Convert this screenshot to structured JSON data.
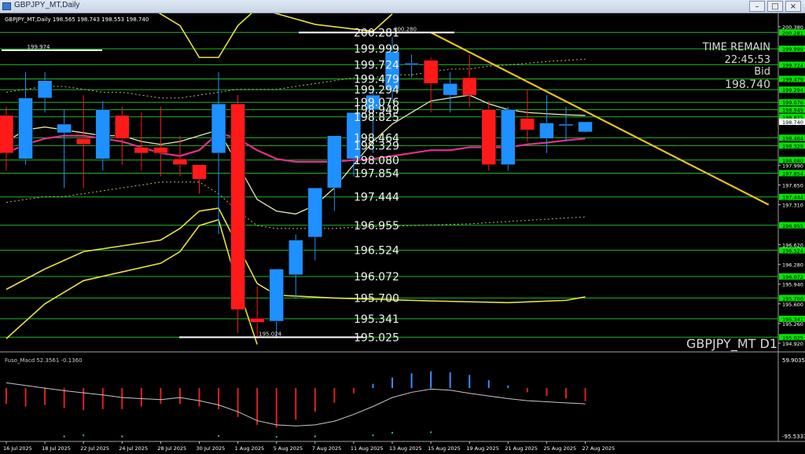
{
  "window": {
    "title": "GBPJPY_MT,Daily",
    "minimize_glyph": "–",
    "maximize_glyph": "□",
    "close_glyph": "×"
  },
  "header": {
    "info": "GBPJPY_MT,Daily   198.565  198.743  198.553  198.740"
  },
  "info_panel": {
    "time_remain_label": "TIME REMAIN",
    "time_remain_value": "22:45:53",
    "bid_label": "Bid",
    "bid_value": "198.740"
  },
  "symbol_watermark": "GBPJPY_MT D1",
  "indicator": {
    "label": "Fuso_Macd 52.3561  -0.1360",
    "scale_top": "59.9035",
    "scale_bottom": "-95.5331",
    "color_main": "#c8c8c8",
    "color_positive": "#3a8cff",
    "color_negative": "#e02020"
  },
  "colors": {
    "background": "#000000",
    "bull_candle": "#1e90ff",
    "bear_candle": "#ff1a1a",
    "level_line": "#2ad82a",
    "trendline": "#e8c020",
    "ma_pink": "#e0308c",
    "band_yellow": "#e8e040",
    "band_white": "#e8e8b0",
    "price_marker": "#00e600"
  },
  "chart_data": {
    "type": "candlestick",
    "symbol": "GBPJPY_MT",
    "timeframe": "Daily",
    "ylim": [
      194.92,
      200.38
    ],
    "price_axis_ticks": [
      "200.380",
      "199.990",
      "197.990",
      "197.650",
      "197.310",
      "196.620",
      "196.280",
      "195.940",
      "195.600",
      "195.260",
      "194.920"
    ],
    "level_lines": [
      {
        "value": 200.281,
        "label": "200.281"
      },
      {
        "value": 199.999,
        "label": "199.999"
      },
      {
        "value": 199.724,
        "label": "199.724"
      },
      {
        "value": 199.479,
        "label": "199.479"
      },
      {
        "value": 199.294,
        "label": "199.294"
      },
      {
        "value": 199.076,
        "label": "199.076"
      },
      {
        "value": 198.949,
        "label": "198.949"
      },
      {
        "value": 198.825,
        "label": "198.825"
      },
      {
        "value": 198.464,
        "label": "198.464"
      },
      {
        "value": 198.329,
        "label": "198.329"
      },
      {
        "value": 198.08,
        "label": "198.080"
      },
      {
        "value": 197.854,
        "label": "197.854"
      },
      {
        "value": 197.444,
        "label": "197.444"
      },
      {
        "value": 196.955,
        "label": "196.955"
      },
      {
        "value": 196.524,
        "label": "196.524"
      },
      {
        "value": 196.072,
        "label": "196.072"
      },
      {
        "value": 195.7,
        "label": "195.700"
      },
      {
        "value": 195.341,
        "label": "195.341"
      },
      {
        "value": 195.025,
        "label": "195.025"
      }
    ],
    "current_price": {
      "value": 198.74,
      "label": "198.740"
    },
    "swing_labels": [
      {
        "value": 199.974,
        "label": "199.974",
        "index": 1
      },
      {
        "value": 200.28,
        "label": "200.280",
        "index": 20
      },
      {
        "value": 195.024,
        "label": "195.024",
        "index": 13
      }
    ],
    "date_labels": [
      {
        "index": 0,
        "label": "16 Jul 2025"
      },
      {
        "index": 2,
        "label": "18 Jul 2025"
      },
      {
        "index": 4,
        "label": "22 Jul 2025"
      },
      {
        "index": 6,
        "label": "24 Jul 2025"
      },
      {
        "index": 8,
        "label": "28 Jul 2025"
      },
      {
        "index": 10,
        "label": "30 Jul 2025"
      },
      {
        "index": 12,
        "label": "1 Aug 2025"
      },
      {
        "index": 14,
        "label": "5 Aug 2025"
      },
      {
        "index": 16,
        "label": "7 Aug 2025"
      },
      {
        "index": 18,
        "label": "11 Aug 2025"
      },
      {
        "index": 20,
        "label": "13 Aug 2025"
      },
      {
        "index": 22,
        "label": "15 Aug 2025"
      },
      {
        "index": 24,
        "label": "19 Aug 2025"
      },
      {
        "index": 26,
        "label": "21 Aug 2025"
      },
      {
        "index": 28,
        "label": "25 Aug 2025"
      },
      {
        "index": 30,
        "label": "27 Aug 2025"
      }
    ],
    "candles": [
      {
        "o": 198.85,
        "h": 199.0,
        "l": 197.9,
        "c": 198.2
      },
      {
        "o": 198.1,
        "h": 199.6,
        "l": 198.0,
        "c": 199.15
      },
      {
        "o": 199.15,
        "h": 199.6,
        "l": 198.9,
        "c": 199.45
      },
      {
        "o": 198.55,
        "h": 198.95,
        "l": 197.6,
        "c": 198.7
      },
      {
        "o": 198.45,
        "h": 199.2,
        "l": 197.6,
        "c": 198.35
      },
      {
        "o": 198.1,
        "h": 199.1,
        "l": 197.9,
        "c": 198.95
      },
      {
        "o": 198.85,
        "h": 199.0,
        "l": 198.0,
        "c": 198.45
      },
      {
        "o": 198.3,
        "h": 198.9,
        "l": 197.9,
        "c": 198.2
      },
      {
        "o": 198.3,
        "h": 199.0,
        "l": 197.8,
        "c": 198.2
      },
      {
        "o": 198.1,
        "h": 198.5,
        "l": 197.8,
        "c": 198.0
      },
      {
        "o": 198.0,
        "h": 197.9,
        "l": 197.5,
        "c": 197.75
      },
      {
        "o": 198.2,
        "h": 199.6,
        "l": 196.8,
        "c": 199.05
      },
      {
        "o": 199.05,
        "h": 199.2,
        "l": 195.1,
        "c": 195.5
      },
      {
        "o": 195.35,
        "h": 195.9,
        "l": 195.0,
        "c": 195.28
      },
      {
        "o": 195.3,
        "h": 196.2,
        "l": 195.0,
        "c": 196.2
      },
      {
        "o": 196.1,
        "h": 196.8,
        "l": 195.7,
        "c": 196.7
      },
      {
        "o": 196.75,
        "h": 197.5,
        "l": 196.35,
        "c": 197.6
      },
      {
        "o": 197.6,
        "h": 198.2,
        "l": 197.2,
        "c": 198.5
      },
      {
        "o": 198.1,
        "h": 198.9,
        "l": 197.8,
        "c": 198.9
      },
      {
        "o": 198.95,
        "h": 199.3,
        "l": 198.2,
        "c": 199.2
      },
      {
        "o": 199.3,
        "h": 200.2,
        "l": 199.1,
        "c": 199.95
      },
      {
        "o": 199.75,
        "h": 199.9,
        "l": 199.5,
        "c": 199.75
      },
      {
        "o": 199.8,
        "h": 199.85,
        "l": 198.9,
        "c": 199.4
      },
      {
        "o": 199.2,
        "h": 199.6,
        "l": 198.9,
        "c": 199.4
      },
      {
        "o": 199.5,
        "h": 199.9,
        "l": 199.0,
        "c": 199.2
      },
      {
        "o": 198.95,
        "h": 199.1,
        "l": 197.9,
        "c": 198.0
      },
      {
        "o": 198.0,
        "h": 199.0,
        "l": 197.9,
        "c": 198.95
      },
      {
        "o": 198.8,
        "h": 199.3,
        "l": 198.4,
        "c": 198.6
      },
      {
        "o": 198.45,
        "h": 199.2,
        "l": 198.2,
        "c": 198.72
      },
      {
        "o": 198.7,
        "h": 199.0,
        "l": 198.4,
        "c": 198.7
      },
      {
        "o": 198.565,
        "h": 198.743,
        "l": 198.553,
        "c": 198.74
      }
    ],
    "ma_pink": [
      198.2,
      198.35,
      198.45,
      198.5,
      198.5,
      198.45,
      198.4,
      198.3,
      198.2,
      198.15,
      198.25,
      198.55,
      198.45,
      198.25,
      198.1,
      198.05,
      198.05,
      198.05,
      198.08,
      198.1,
      198.15,
      198.2,
      198.25,
      198.25,
      198.3,
      198.3,
      198.3,
      198.35,
      198.38,
      198.42,
      198.45
    ],
    "band_white": [
      198.4,
      198.6,
      198.65,
      198.6,
      198.55,
      198.5,
      198.5,
      198.4,
      198.35,
      198.4,
      198.5,
      198.6,
      198.0,
      197.4,
      197.2,
      197.15,
      197.3,
      197.6,
      198.0,
      198.4,
      198.7,
      198.9,
      199.1,
      199.15,
      199.2,
      199.05,
      198.95,
      198.9,
      198.88,
      198.86,
      198.85
    ],
    "band_upper_dotted": [
      199.25,
      199.3,
      199.35,
      199.35,
      199.3,
      199.25,
      199.25,
      199.2,
      199.15,
      199.15,
      199.2,
      199.25,
      199.3,
      199.3,
      199.3,
      199.35,
      199.4,
      199.45,
      199.5,
      199.5,
      199.55,
      199.55,
      199.6,
      199.65,
      199.65,
      199.7,
      199.72,
      199.75,
      199.78,
      199.8,
      199.82
    ],
    "band_lower_dotted": [
      197.35,
      197.4,
      197.45,
      197.45,
      197.5,
      197.55,
      197.6,
      197.65,
      197.7,
      197.7,
      197.7,
      197.5,
      197.2,
      196.95,
      196.9,
      196.9,
      196.9,
      196.9,
      196.92,
      196.93,
      196.94,
      196.95,
      196.96,
      196.97,
      196.98,
      197.0,
      197.02,
      197.04,
      197.06,
      197.08,
      197.1
    ],
    "band_outer_upper": [
      {
        "i": 7.5,
        "v": 200.7
      },
      {
        "i": 9,
        "v": 200.4
      },
      {
        "i": 10,
        "v": 199.85
      },
      {
        "i": 11,
        "v": 199.85
      },
      {
        "i": 12,
        "v": 200.4
      },
      {
        "i": 13,
        "v": 200.7
      },
      {
        "i": 16,
        "v": 200.42
      },
      {
        "i": 19,
        "v": 200.3
      },
      {
        "i": 20,
        "v": 200.6
      }
    ],
    "band_outer_lower": [
      {
        "i": 0,
        "v": 195.0
      },
      {
        "i": 2,
        "v": 195.6
      },
      {
        "i": 4,
        "v": 196.0
      },
      {
        "i": 6,
        "v": 196.15
      },
      {
        "i": 8,
        "v": 196.3
      },
      {
        "i": 9,
        "v": 196.5
      },
      {
        "i": 10,
        "v": 196.95
      },
      {
        "i": 11,
        "v": 197.05
      },
      {
        "i": 12,
        "v": 195.9
      },
      {
        "i": 13,
        "v": 194.9
      }
    ],
    "band_lower_solid": [
      {
        "i": 0,
        "v": 195.85
      },
      {
        "i": 2,
        "v": 196.2
      },
      {
        "i": 4,
        "v": 196.5
      },
      {
        "i": 6,
        "v": 196.6
      },
      {
        "i": 8,
        "v": 196.7
      },
      {
        "i": 9,
        "v": 196.9
      },
      {
        "i": 10,
        "v": 197.2
      },
      {
        "i": 11,
        "v": 197.25
      },
      {
        "i": 12,
        "v": 196.6
      },
      {
        "i": 13,
        "v": 195.95
      },
      {
        "i": 14,
        "v": 195.75
      },
      {
        "i": 17,
        "v": 195.7
      },
      {
        "i": 22,
        "v": 195.65
      },
      {
        "i": 26,
        "v": 195.62
      },
      {
        "i": 29,
        "v": 195.66
      },
      {
        "i": 30,
        "v": 195.72
      }
    ],
    "trendline": [
      {
        "i": 22,
        "v": 200.28
      },
      {
        "i": 39.5,
        "v": 197.31
      }
    ],
    "macd_main": [
      10,
      5,
      0,
      -5,
      -9,
      -13,
      -18,
      -20,
      -22,
      -18,
      -24,
      -32,
      -45,
      -62,
      -70,
      -72,
      -70,
      -63,
      -50,
      -35,
      -18,
      -8,
      -2,
      -4,
      -10,
      -15,
      -20,
      -24,
      -26,
      -28,
      -30
    ],
    "macd_hist": [
      -30,
      -35,
      -32,
      -38,
      -42,
      -40,
      -40,
      -35,
      -30,
      -30,
      -35,
      -40,
      -55,
      -70,
      -75,
      -60,
      -45,
      -28,
      -10,
      8,
      20,
      28,
      32,
      30,
      25,
      15,
      5,
      -8,
      -15,
      -20,
      -25
    ],
    "macd_dots": [
      {
        "i": 3,
        "v": -92
      },
      {
        "i": 4,
        "v": -90
      },
      {
        "i": 6,
        "v": -92
      },
      {
        "i": 11,
        "v": -91
      },
      {
        "i": 14,
        "v": -93
      },
      {
        "i": 16,
        "v": -92
      },
      {
        "i": 19,
        "v": -90
      },
      {
        "i": 20,
        "v": -85
      },
      {
        "i": 22,
        "v": -84
      }
    ],
    "macd_ylim": [
      -95.5331,
      59.9035
    ]
  }
}
